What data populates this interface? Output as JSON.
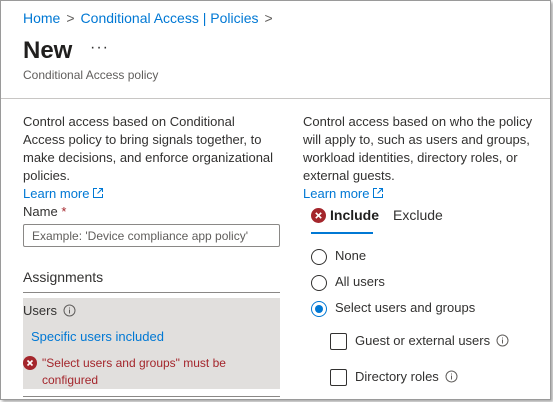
{
  "breadcrumb": {
    "home": "Home",
    "section": "Conditional Access | Policies"
  },
  "header": {
    "title": "New",
    "more": "···",
    "subtitle": "Conditional Access policy"
  },
  "left": {
    "description": "Control access based on Conditional Access policy to bring signals together, to make decisions, and enforce organizational policies.",
    "learn_more": "Learn more",
    "name_label": "Name",
    "name_required": "*",
    "name_placeholder": "Example: 'Device compliance app policy'",
    "assignments_label": "Assignments",
    "users_label": "Users",
    "users_value": "Specific users included",
    "users_error": "\"Select users and groups\" must be configured"
  },
  "right": {
    "description": "Control access based on who the policy will apply to, such as users and groups, workload identities, directory roles, or external guests.",
    "learn_more": "Learn more",
    "tabs": {
      "include": "Include",
      "exclude": "Exclude"
    },
    "radios": {
      "none": "None",
      "all_users": "All users",
      "select": "Select users and groups"
    },
    "checkboxes": {
      "guest": "Guest or external users",
      "directory": "Directory roles"
    }
  },
  "colors": {
    "accent": "#0078d4",
    "error": "#a4262c",
    "selected_bg": "#e1dfdd"
  }
}
